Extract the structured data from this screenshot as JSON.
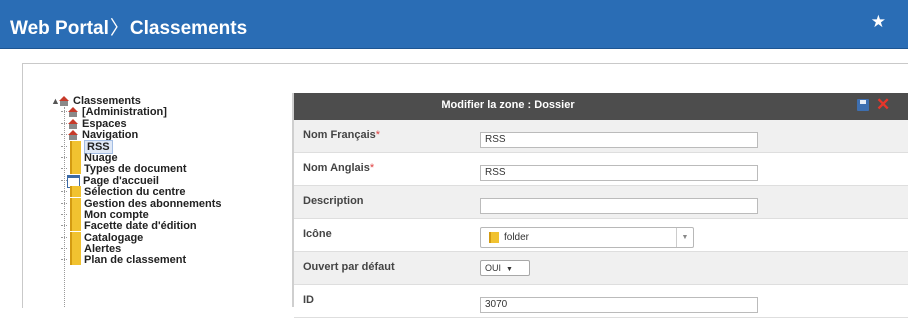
{
  "header": {
    "app": "Web Portal",
    "separator": "〉",
    "section": "Classements",
    "star_icon": "star-icon"
  },
  "tree": {
    "root": {
      "label": "Classements",
      "icon": "red-house-icon"
    },
    "items": [
      {
        "label": "[Administration]",
        "icon": "red-house-icon"
      },
      {
        "label": "Espaces",
        "icon": "red-house-icon"
      },
      {
        "label": "Navigation",
        "icon": "red-house-icon"
      },
      {
        "label": "RSS",
        "icon": "folder-icon",
        "selected": true
      },
      {
        "label": "Nuage",
        "icon": "folder-icon"
      },
      {
        "label": "Types de document",
        "icon": "folder-icon"
      },
      {
        "label": "Page d'accueil",
        "icon": "page-icon"
      },
      {
        "label": "Sélection du centre",
        "icon": "folder-icon"
      },
      {
        "label": "Gestion des abonnements",
        "icon": "folder-icon"
      },
      {
        "label": "Mon compte",
        "icon": "folder-icon"
      },
      {
        "label": "Facette date d'édition",
        "icon": "folder-icon"
      },
      {
        "label": "Catalogage",
        "icon": "folder-icon"
      },
      {
        "label": "Alertes",
        "icon": "folder-icon"
      },
      {
        "label": "Plan de classement",
        "icon": "folder-icon"
      }
    ]
  },
  "form": {
    "title": "Modifier la zone : Dossier",
    "fields": {
      "nom_fr": {
        "label": "Nom Français",
        "required": "*",
        "value": "RSS"
      },
      "nom_en": {
        "label": "Nom Anglais",
        "required": "*",
        "value": "RSS"
      },
      "description": {
        "label": "Description",
        "value": ""
      },
      "icone": {
        "label": "Icône",
        "value": "folder"
      },
      "ouvert": {
        "label": "Ouvert par défaut",
        "value": "OUI",
        "caret": "▼"
      },
      "id": {
        "label": "ID",
        "value": "3070"
      }
    }
  },
  "colors": {
    "header_bg": "#2a6db5",
    "form_bar_bg": "#4d4d4d",
    "close_red": "#e8352a",
    "required_red": "#e04040"
  }
}
